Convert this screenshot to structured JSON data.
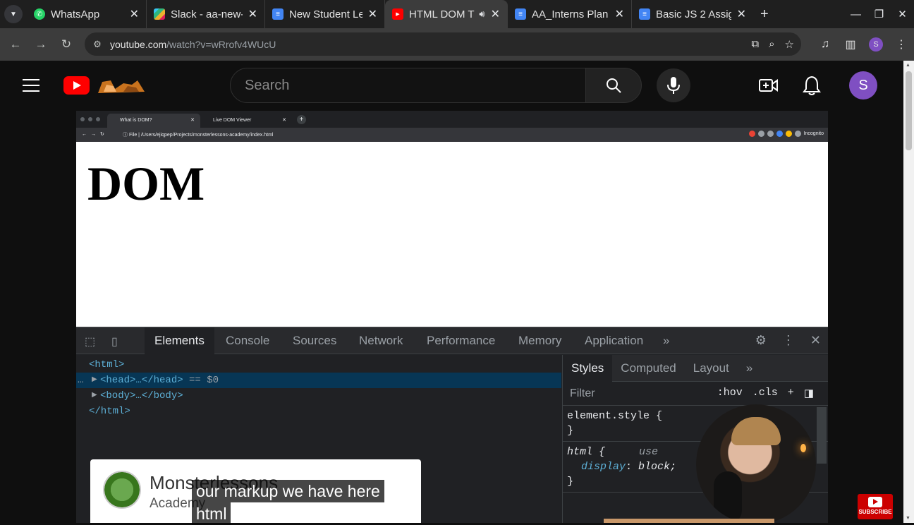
{
  "browser": {
    "tabs": [
      {
        "title": "WhatsApp",
        "icon": "whatsapp-icon",
        "color": "#25d366"
      },
      {
        "title": "Slack - aa-new-ir",
        "icon": "slack-icon",
        "color": "#e01e5a"
      },
      {
        "title": "New Student Le",
        "icon": "docs-icon",
        "color": "#4285f4"
      },
      {
        "title": "HTML DOM T",
        "icon": "youtube-icon",
        "color": "#ff0000",
        "active": true,
        "audio": true
      },
      {
        "title": "AA_Interns Plan",
        "icon": "docs-icon",
        "color": "#4285f4"
      },
      {
        "title": "Basic JS 2 Assig",
        "icon": "docs-icon",
        "color": "#4285f4"
      }
    ],
    "url_host": "youtube.com",
    "url_path": "/watch?v=wRrofv4WUcU",
    "profile_initial": "S"
  },
  "youtube": {
    "search_placeholder": "Search",
    "avatar_initial": "S",
    "accent": "#ff0000"
  },
  "video": {
    "inner_tabs": [
      "What is DOM?",
      "Live DOM Viewer"
    ],
    "inner_url_prefix": "File",
    "inner_url": "/Users/ejiqpep/Projects/monsterlessons-academy/index.html",
    "inner_mode": "Incognito",
    "page_heading": "DOM",
    "devtools": {
      "tabs": [
        "Elements",
        "Console",
        "Sources",
        "Network",
        "Performance",
        "Memory",
        "Application"
      ],
      "overflow": "»",
      "dom_lines": [
        "<html>",
        "<head>…</head>",
        "== $0",
        "<body>…</body>",
        "</html>"
      ],
      "dom_dots": "…",
      "styles_tabs": [
        "Styles",
        "Computed",
        "Layout"
      ],
      "filter_placeholder": "Filter",
      "filter_hov": ":hov",
      "filter_cls": ".cls",
      "rule1_selector": "element.style {",
      "rule1_close": "}",
      "rule2_selector": "html {",
      "rule2_source": "use",
      "rule2_prop": "display",
      "rule2_value": "block;",
      "rule2_close": "}"
    },
    "channel_card": {
      "name": "Monsterlessons",
      "sub": "Academy"
    },
    "caption_line1": "our markup we have here",
    "caption_line2": "html",
    "subscribe_label": "SUBSCRIBE"
  }
}
